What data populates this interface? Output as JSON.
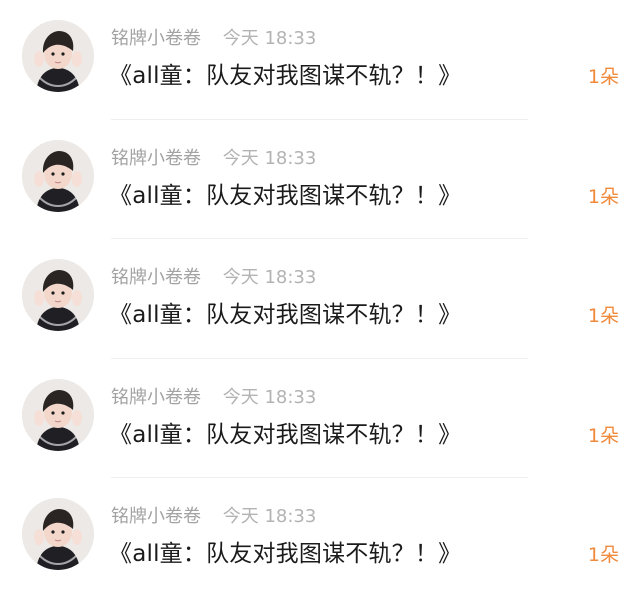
{
  "feed": {
    "items": [
      {
        "username": "铭牌小卷卷",
        "time": "今天 18:33",
        "message": "《all童：队友对我图谋不轨？！》",
        "flowers": "1朵"
      },
      {
        "username": "铭牌小卷卷",
        "time": "今天 18:33",
        "message": "《all童：队友对我图谋不轨？！》",
        "flowers": "1朵"
      },
      {
        "username": "铭牌小卷卷",
        "time": "今天 18:33",
        "message": "《all童：队友对我图谋不轨？！》",
        "flowers": "1朵"
      },
      {
        "username": "铭牌小卷卷",
        "time": "今天 18:33",
        "message": "《all童：队友对我图谋不轨？！》",
        "flowers": "1朵"
      },
      {
        "username": "铭牌小卷卷",
        "time": "今天 18:33",
        "message": "《all童：队友对我图谋不轨？！》",
        "flowers": "1朵"
      }
    ]
  },
  "colors": {
    "accent": "#f08a3c",
    "meta_text": "#a8a8a8",
    "body_text": "#1b1b1b",
    "divider": "#efefef"
  },
  "icons": {
    "avatar": "user-avatar-photo"
  }
}
